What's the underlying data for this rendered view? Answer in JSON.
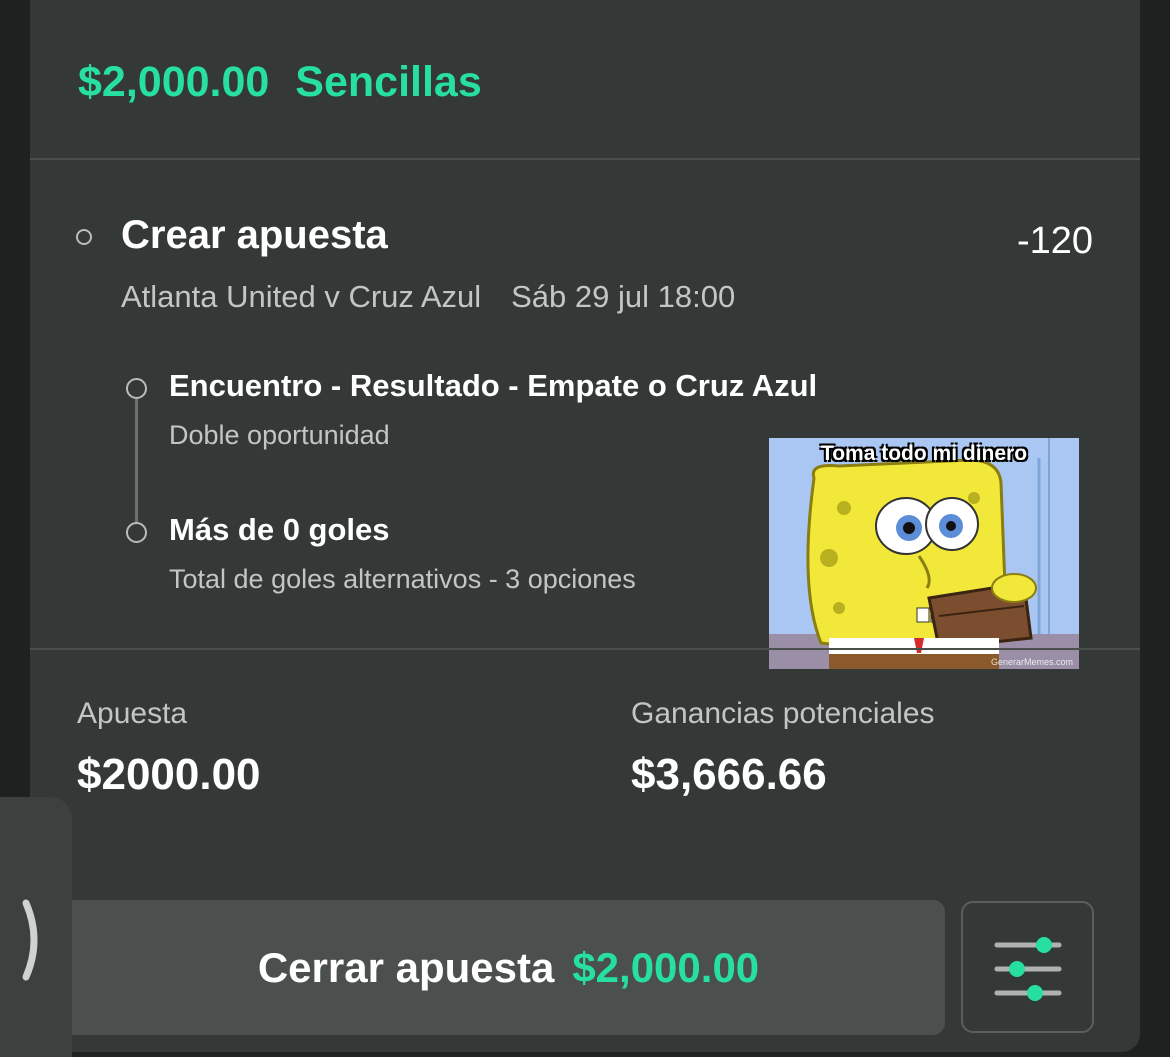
{
  "header": {
    "amount": "$2,000.00",
    "type": "Sencillas"
  },
  "bet": {
    "title": "Crear apuesta",
    "odds": "-120",
    "match": "Atlanta United v Cruz Azul",
    "datetime": "Sáb 29 jul 18:00",
    "legs": [
      {
        "title": "Encuentro - Resultado - Empate o Cruz Azul",
        "subtitle": "Doble oportunidad"
      },
      {
        "title": "Más de 0 goles",
        "subtitle": "Total de goles alternativos - 3 opciones"
      }
    ]
  },
  "meme": {
    "caption": "Toma todo mi dinero",
    "credit": "GenerarMemes.com"
  },
  "summary": {
    "stake_label": "Apuesta",
    "stake_value": "$2000.00",
    "winnings_label": "Ganancias potenciales",
    "winnings_value": "$3,666.66"
  },
  "cashout": {
    "label": "Cerrar apuesta",
    "amount": "$2,000.00"
  },
  "colors": {
    "accent": "#27e0a0",
    "card": "#343836",
    "background": "#1f2120"
  },
  "icons": {
    "side_tab": "chevron-right-icon",
    "settings": "sliders-icon"
  }
}
